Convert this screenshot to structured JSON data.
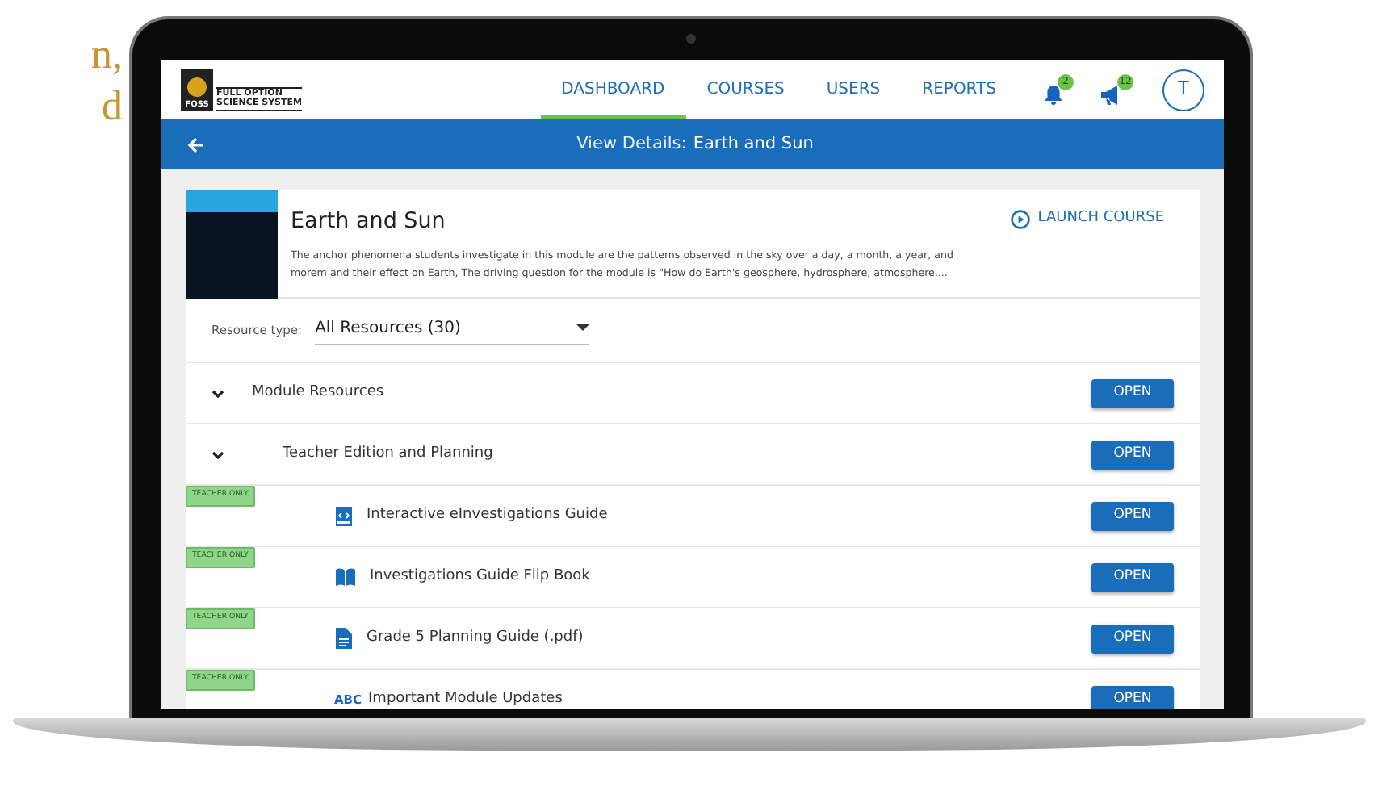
{
  "slide_text": [
    "n,",
    "d"
  ],
  "logo": {
    "mark": "FOSS",
    "line_1": "FULL OPTION",
    "line_2": "SCIENCE SYSTEM"
  },
  "navbar": {
    "links": [
      {
        "label": "DASHBOARD",
        "selected": true
      },
      {
        "label": "COURSES",
        "selected": false
      },
      {
        "label": "USERS",
        "selected": false
      },
      {
        "label": "REPORTS",
        "selected": false
      }
    ],
    "notifications_count": "2",
    "announcements_count": "12",
    "avatar": "T"
  },
  "title_bar": {
    "label": "View Details:",
    "title": "Earth and Sun"
  },
  "course": {
    "title": "Earth and Sun",
    "description": "The anchor phenomena students investigate in this module are the patterns observed in the sky over a day, a month, a year, and morem and their effect on Earth, The driving question for the module is \"How do Earth's geosphere, hydrosphere, atmosphere,...",
    "launch": "LAUNCH COURSE"
  },
  "resource_type": {
    "label": "Resource type:",
    "value": "All Resources (30)"
  },
  "resources": [
    {
      "kind": "group",
      "title": "Module Resources",
      "expanded": true,
      "button": "OPEN",
      "children": [
        {
          "kind": "group",
          "title": "Teacher Edition and Planning",
          "expanded": true,
          "button": "OPEN",
          "children": [
            {
              "kind": "interactive",
              "title": "Interactive eInvestigations Guide",
              "badge": "TEACHER ONLY",
              "button": "OPEN"
            },
            {
              "kind": "book",
              "title": "Investigations Guide Flip Book",
              "badge": "TEACHER ONLY",
              "button": "OPEN"
            },
            {
              "kind": "pdf",
              "title": "Grade 5 Planning Guide (.pdf)",
              "badge": "TEACHER ONLY",
              "button": "OPEN"
            },
            {
              "kind": "text",
              "icon_text": "ABC",
              "title": "Important Module Updates",
              "badge": "TEACHER ONLY",
              "button": "OPEN"
            }
          ]
        }
      ]
    }
  ]
}
